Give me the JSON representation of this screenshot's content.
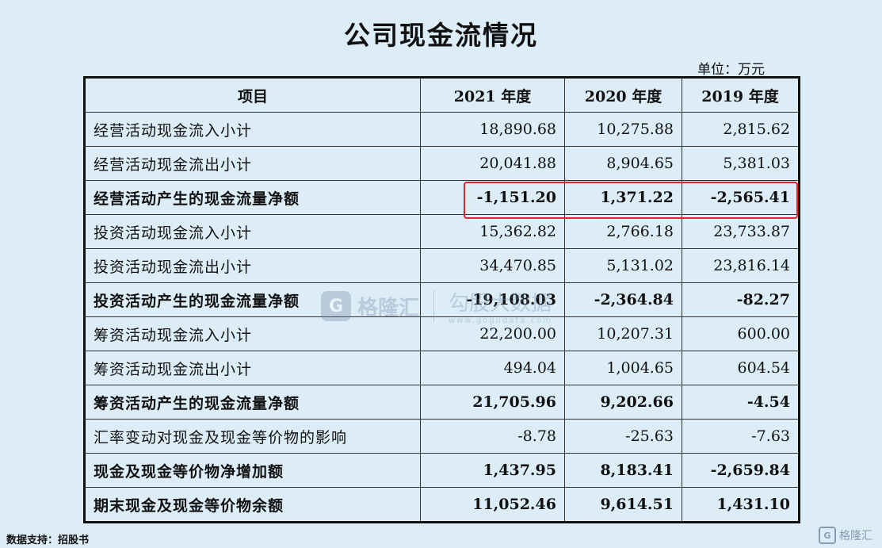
{
  "title": "公司现金流情况",
  "unit": "单位：万元",
  "headers": [
    "项目",
    "2021 年度",
    "2020 年度",
    "2019 年度"
  ],
  "rows": [
    {
      "label": "经营活动现金流入小计",
      "v": [
        "18,890.68",
        "10,275.88",
        "2,815.62"
      ],
      "bold": false
    },
    {
      "label": "经营活动现金流出小计",
      "v": [
        "20,041.88",
        "8,904.65",
        "5,381.03"
      ],
      "bold": false
    },
    {
      "label": "经营活动产生的现金流量净额",
      "v": [
        "-1,151.20",
        "1,371.22",
        "-2,565.41"
      ],
      "bold": true
    },
    {
      "label": "投资活动现金流入小计",
      "v": [
        "15,362.82",
        "2,766.18",
        "23,733.87"
      ],
      "bold": false
    },
    {
      "label": "投资活动现金流出小计",
      "v": [
        "34,470.85",
        "5,131.02",
        "23,816.14"
      ],
      "bold": false
    },
    {
      "label": "投资活动产生的现金流量净额",
      "v": [
        "-19,108.03",
        "-2,364.84",
        "-82.27"
      ],
      "bold": true
    },
    {
      "label": "筹资活动现金流入小计",
      "v": [
        "22,200.00",
        "10,207.31",
        "600.00"
      ],
      "bold": false
    },
    {
      "label": "筹资活动现金流出小计",
      "v": [
        "494.04",
        "1,004.65",
        "604.54"
      ],
      "bold": false
    },
    {
      "label": "筹资活动产生的现金流量净额",
      "v": [
        "21,705.96",
        "9,202.66",
        "-4.54"
      ],
      "bold": true
    },
    {
      "label": "汇率变动对现金及现金等价物的影响",
      "v": [
        "-8.78",
        "-25.63",
        "-7.63"
      ],
      "bold": false
    },
    {
      "label": "现金及现金等价物净增加额",
      "v": [
        "1,437.95",
        "8,183.41",
        "-2,659.84"
      ],
      "bold": true
    },
    {
      "label": "期末现金及现金等价物余额",
      "v": [
        "11,052.46",
        "9,614.51",
        "1,431.10"
      ],
      "bold": true
    }
  ],
  "watermark": {
    "brand": "格隆汇",
    "sub": "勾股大数据",
    "url": "www.gogudata.com"
  },
  "source": "数据支持：招股书",
  "footer_brand": "格隆汇",
  "colors": {
    "background": "#dcedf8",
    "highlight": "#e0262a"
  }
}
